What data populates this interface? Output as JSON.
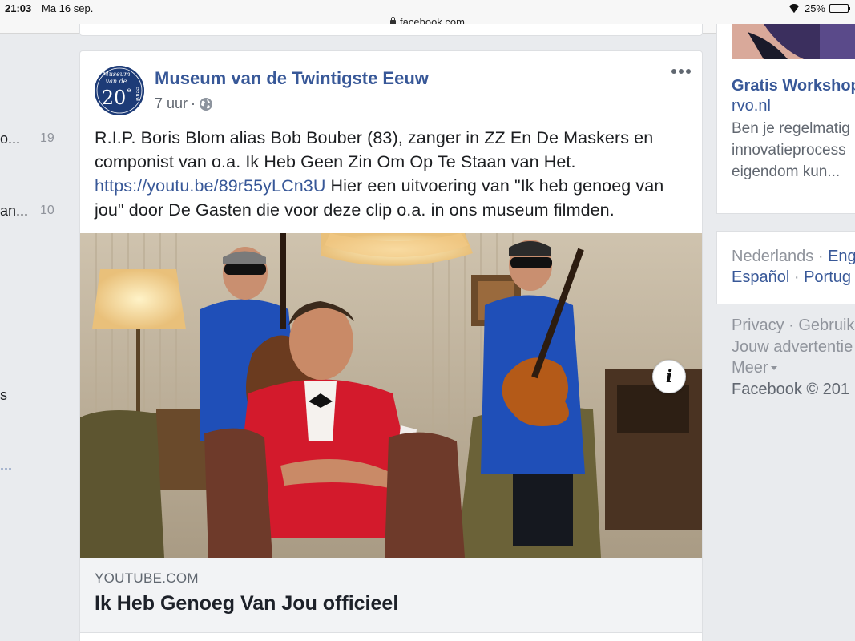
{
  "status_bar": {
    "time": "21:03",
    "date": "Ma 16 sep.",
    "url": "facebook.com",
    "battery": "25%",
    "battery_level": 0.25
  },
  "left_rail": {
    "items": [
      {
        "label": "o...",
        "count": "19"
      },
      {
        "label": "an...",
        "count": "10"
      },
      {
        "label": "s",
        "count": ""
      }
    ],
    "more_link": "..."
  },
  "post": {
    "page_name": "Museum van de Twintigste Eeuw",
    "time": "7 uur",
    "separator": "·",
    "avatar_text": {
      "line1": "Museum",
      "line2": "van de",
      "big": "20",
      "sup": "e",
      "side": "eeuw"
    },
    "text_before": "R.I.P. Boris Blom alias Bob Bouber (83), zanger in ZZ En De Maskers en componist van o.a. Ik Heb Geen Zin Om Op Te Staan van Het. ",
    "link": "https://youtu.be/89r55yLCn3U",
    "text_after": " Hier een uitvoering van \"Ik heb genoeg van jou\" door De Gasten die voor deze clip o.a. in ons museum filmden.",
    "info_button": "i",
    "link_preview": {
      "domain": "YOUTUBE.COM",
      "title": "Ik Heb Genoeg Van Jou officieel"
    }
  },
  "right_column": {
    "ad": {
      "title": "Gratis Workshop",
      "domain": "rvo.nl",
      "desc_lines": [
        "Ben je regelmatig",
        "innovatieprocess",
        "eigendom kun..."
      ]
    },
    "languages": {
      "current": "Nederlands",
      "sep": "·",
      "english": "Eng",
      "spanish": "Español",
      "portuguese": "Portug"
    },
    "footer": {
      "privacy": "Privacy",
      "terms": "Gebruik",
      "ads": "Jouw advertentie",
      "more": "Meer",
      "copyright": "Facebook © 201"
    }
  },
  "colors": {
    "brand_link": "#385898",
    "background": "#e9ebee",
    "muted": "#90949c"
  }
}
